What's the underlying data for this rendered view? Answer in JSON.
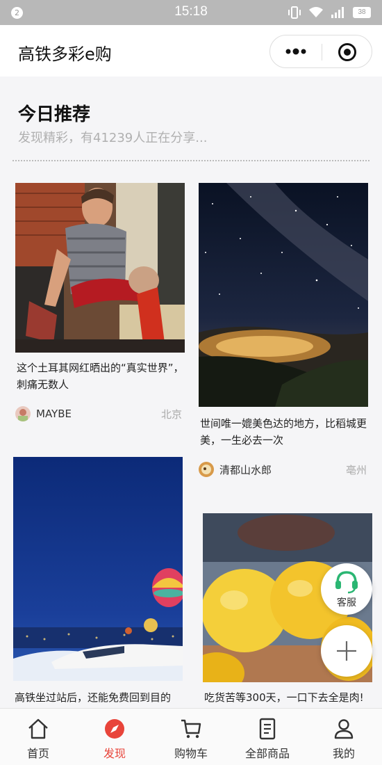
{
  "status_bar": {
    "notification_count": "2",
    "time": "15:18",
    "battery": "38",
    "icons": [
      "vibrate-icon",
      "wifi-icon",
      "signal-icon",
      "battery-icon"
    ]
  },
  "header": {
    "title": "高铁多彩e购",
    "more_icon": "more-dots-icon",
    "close_icon": "target-icon"
  },
  "section": {
    "title": "今日推荐",
    "subtitle": "发现精彩，有41239人正在分享..."
  },
  "cards": [
    {
      "description": "这个土耳其网红晒出的“真实世界”，刺痛无数人",
      "author": "MAYBE",
      "location": "北京"
    },
    {
      "description": "世间唯一媲美色达的地方，比稻城更美，一生必去一次",
      "author": "清都山水郎",
      "location": "亳州"
    },
    {
      "description": "高铁坐过站后，还能免费回到目的",
      "author": "",
      "location": ""
    },
    {
      "description": "吃货苦等300天，一口下去全是肉!",
      "author": "",
      "location": ""
    }
  ],
  "floating": {
    "service_label": "客服"
  },
  "tabbar": {
    "active_color": "#e8443a",
    "items": [
      {
        "label": "首页",
        "icon": "home-icon"
      },
      {
        "label": "发现",
        "icon": "compass-icon"
      },
      {
        "label": "购物车",
        "icon": "cart-icon"
      },
      {
        "label": "全部商品",
        "icon": "list-document-icon"
      },
      {
        "label": "我的",
        "icon": "user-icon"
      }
    ]
  }
}
